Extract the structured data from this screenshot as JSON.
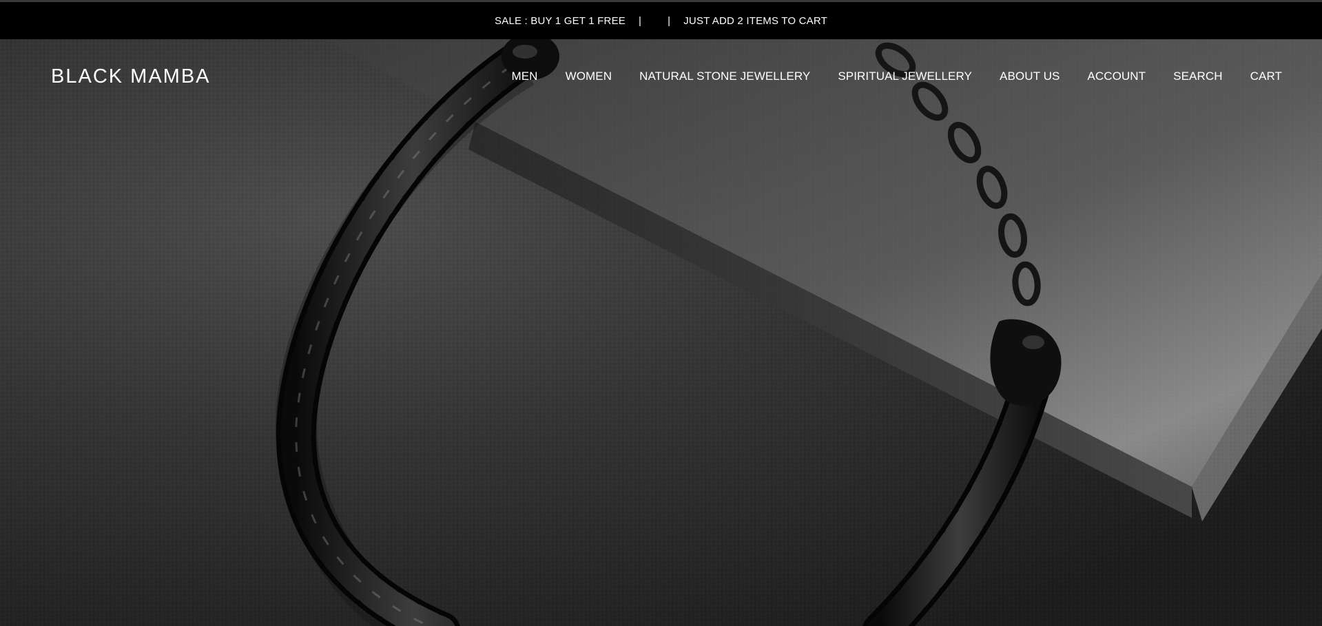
{
  "announcement": {
    "part1": "SALE : BUY 1 GET 1 FREE",
    "separator": "|",
    "part2": "JUST ADD 2 ITEMS TO CART"
  },
  "header": {
    "logo_text": "BLACK MAMBA",
    "nav": [
      {
        "label": "MEN"
      },
      {
        "label": "WOMEN"
      },
      {
        "label": "NATURAL STONE JEWELLERY"
      },
      {
        "label": "SPIRITUAL JEWELLERY"
      },
      {
        "label": "ABOUT US"
      },
      {
        "label": "ACCOUNT"
      },
      {
        "label": "SEARCH"
      },
      {
        "label": "CART"
      }
    ]
  },
  "hero": {
    "image_subject": "black-chain-bracelet-on-slate"
  },
  "colors": {
    "announcement_bg": "#000000",
    "text": "#ffffff",
    "hero_stone": "#3a3a3a"
  }
}
